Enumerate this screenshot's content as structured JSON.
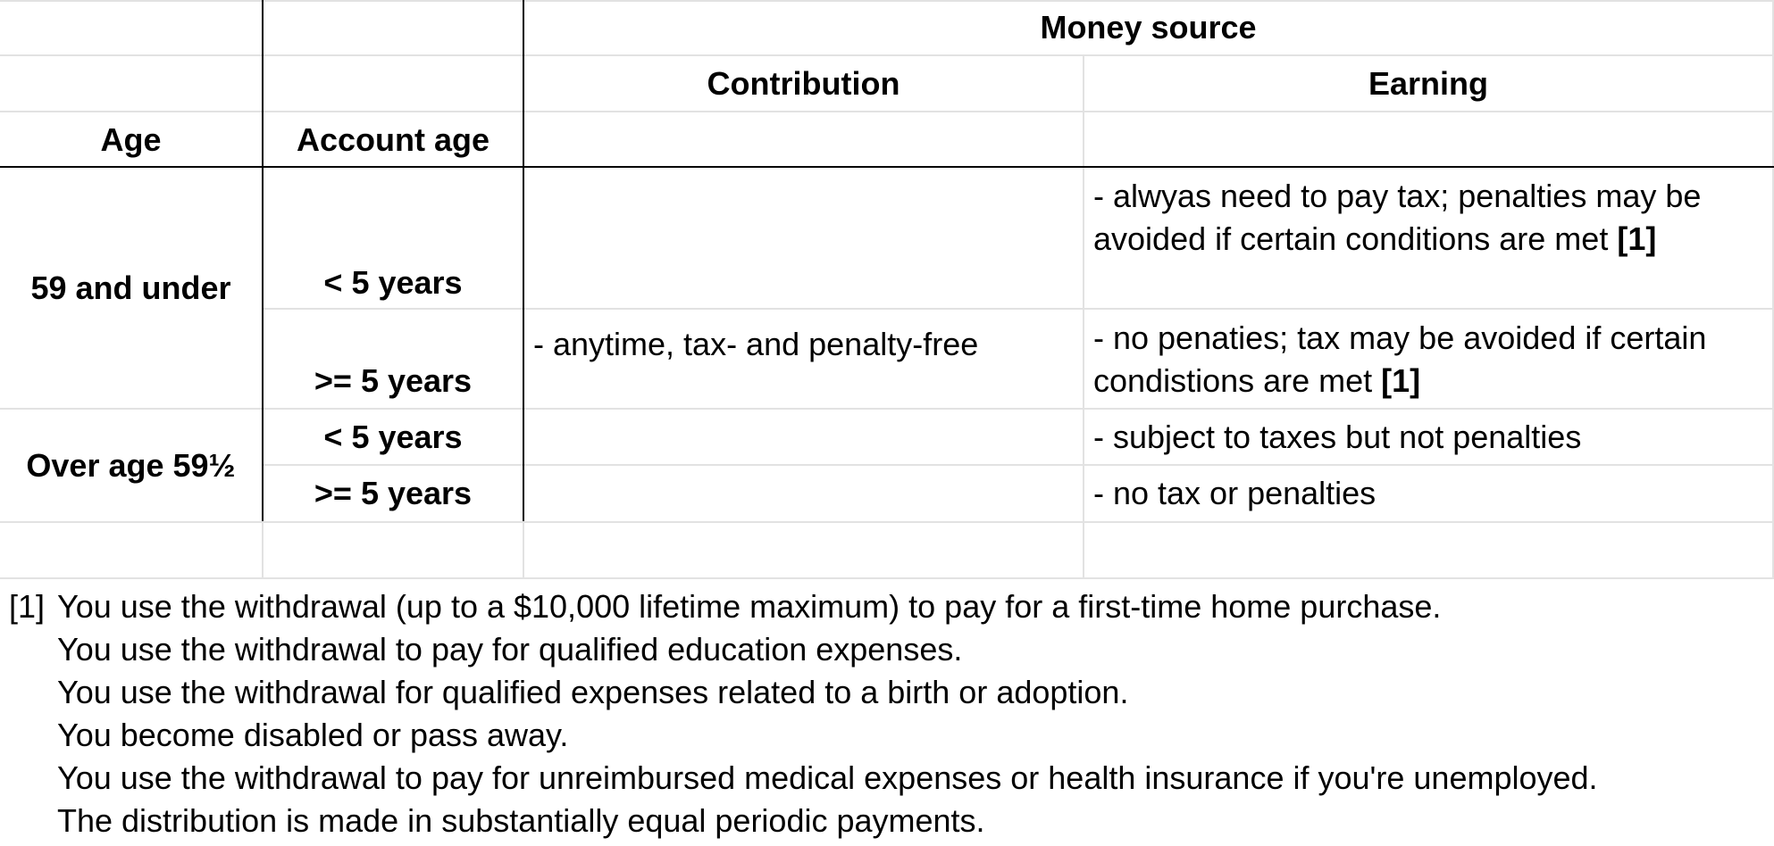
{
  "header": {
    "money_source": "Money source",
    "contribution": "Contribution",
    "earning": "Earning",
    "age": "Age",
    "account_age": "Account age"
  },
  "rows": {
    "age_59_under": "59 and under",
    "age_over_59": "Over age 59½",
    "lt5_a": "< 5 years",
    "ge5_a": ">= 5 years",
    "lt5_b": "< 5 years",
    "ge5_b": ">= 5 years",
    "contribution_text": "- anytime, tax- and penalty-free",
    "earn_1": "- alwyas need to pay tax; penalties may be avoided if certain conditions are met",
    "earn_1_ref": "[1]",
    "earn_2": "- no penaties; tax may be avoided if certain condistions are met",
    "earn_2_ref": "[1]",
    "earn_3": "- subject to taxes but not penalties",
    "earn_4": "- no tax or penalties"
  },
  "footnote": {
    "marker": "[1]",
    "lines": [
      "You use the withdrawal (up to a $10,000 lifetime maximum) to pay for a first-time home purchase.",
      "You use the withdrawal to pay for qualified education expenses.",
      "You use the withdrawal for qualified expenses related to a birth or adoption.",
      "You become disabled or pass away.",
      "You use the withdrawal to pay for unreimbursed medical expenses or health insurance if you're unemployed.",
      "The distribution is made in substantially equal periodic payments."
    ]
  }
}
